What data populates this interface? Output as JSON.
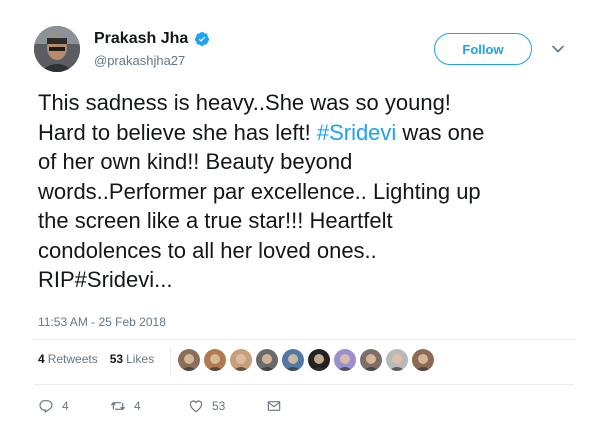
{
  "author": {
    "display_name": "Prakash Jha",
    "handle": "@prakashjha27",
    "verified": true
  },
  "header": {
    "follow_label": "Follow"
  },
  "tweet": {
    "text_parts": [
      "This sadness is heavy..She was so young!\nHard to believe she has left! ",
      "#Sridevi",
      " was one\nof her own kind!! Beauty beyond\nwords..Performer par excellence.. Lighting up\nthe screen like a true star!!! Heartfelt\ncondolences to all her loved ones..\nRIP#Sridevi..."
    ],
    "timestamp": "11:53 AM - 25 Feb 2018"
  },
  "stats": {
    "retweets_count": "4",
    "retweets_label": "Retweets",
    "likes_count": "53",
    "likes_label": "Likes"
  },
  "actions": {
    "reply_count": "4",
    "retweet_count": "4",
    "like_count": "53"
  },
  "colors": {
    "accent": "#1da1f2",
    "muted": "#657786",
    "text": "#14171a",
    "divider": "#e6ecf0"
  },
  "likers": [
    {
      "icon": "liker-avatar-1",
      "color": "#8a6d5a"
    },
    {
      "icon": "liker-avatar-2",
      "color": "#b07a4f"
    },
    {
      "icon": "liker-avatar-3",
      "color": "#c79f7b"
    },
    {
      "icon": "liker-avatar-4",
      "color": "#6a6a6a"
    },
    {
      "icon": "liker-avatar-5",
      "color": "#4f7aa3"
    },
    {
      "icon": "liker-avatar-6",
      "color": "#222222"
    },
    {
      "icon": "liker-avatar-7",
      "color": "#9b8fd1"
    },
    {
      "icon": "liker-avatar-8",
      "color": "#7c6f66"
    },
    {
      "icon": "liker-avatar-9",
      "color": "#b9b9b9"
    },
    {
      "icon": "liker-avatar-10",
      "color": "#8c6b55"
    }
  ]
}
